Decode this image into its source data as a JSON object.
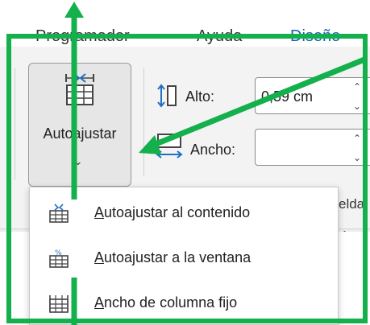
{
  "tabs": [
    {
      "label": "Programador",
      "active": false
    },
    {
      "label": "Ayuda",
      "active": false
    },
    {
      "label": "Diseño",
      "active": true
    }
  ],
  "ribbon": {
    "autofit_button_label": "Autoajustar",
    "height_label": "Alto:",
    "height_value": "0,59 cm",
    "width_label": "Ancho:",
    "width_value": "",
    "cut_text": "elda",
    "ruler_cut": "1"
  },
  "menu": {
    "items": [
      {
        "prefix": "A",
        "rest": "utoajustar al contenido",
        "icon": "autofit-contents-icon"
      },
      {
        "prefix": "A",
        "rest": "utoajustar a la ventana",
        "icon": "autofit-window-icon"
      },
      {
        "prefix": "A",
        "rest": "ncho de columna fijo",
        "icon": "fixed-column-width-icon"
      }
    ]
  },
  "colors": {
    "annotation": "#13b04c",
    "icon_blue": "#1f6fc4",
    "ribbon_bg": "#f3f3f3"
  }
}
